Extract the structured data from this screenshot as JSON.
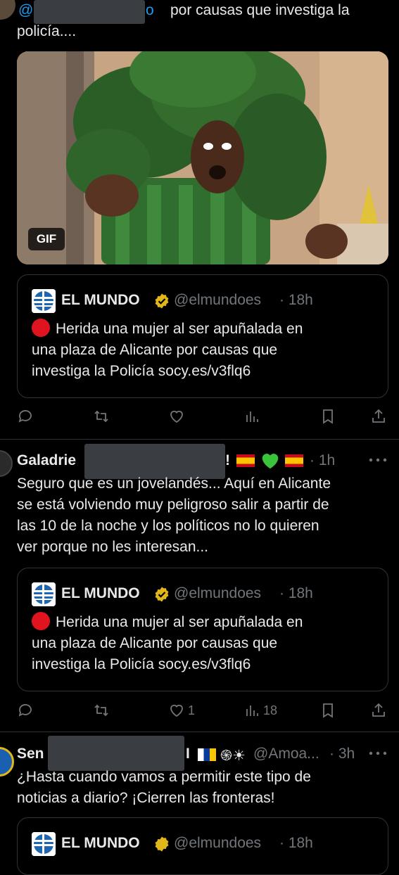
{
  "tweet1": {
    "mention": "@",
    "mention_tail": "o",
    "text_line1": "por causas que investiga la",
    "text_line2": "policía....",
    "gif_badge": "GIF",
    "actions": {
      "reply": "",
      "retweet": "",
      "like": "",
      "views": ""
    }
  },
  "quote": {
    "name": "EL MUNDO",
    "handle": "@elmundoes",
    "time": "· 18h",
    "line1": "Herida una mujer al ser apuñalada en",
    "line2": "una plaza de Alicante por causas que",
    "line3": "investiga la Policía socy.es/v3flq6"
  },
  "tweet2": {
    "author_start": "Galadrie",
    "author_end": "!",
    "time": "· 1h",
    "line1": "Seguro que es un jovelandés... Aquí en Alicante",
    "line2": "se está volviendo muy peligroso salir a partir de",
    "line3": "las 10 de la noche y los políticos  no lo quieren",
    "line4": "ver porque no les interesan...",
    "likes": "1",
    "views": "18"
  },
  "tweet3": {
    "author_start": "Sen",
    "author_end": "I",
    "symbols": "֍☀",
    "handle": "@Amoa...",
    "time": "· 3h",
    "line1": "¿Hasta cuando vamos a permitir este tipo de",
    "line2": "noticias a diario? ¡Cierren las fronteras!"
  },
  "colors": {
    "background": "#000000",
    "text": "#e7e9ea",
    "muted": "#71767b",
    "verified": "#e2b719",
    "broccoli": "#2e6b2b"
  }
}
